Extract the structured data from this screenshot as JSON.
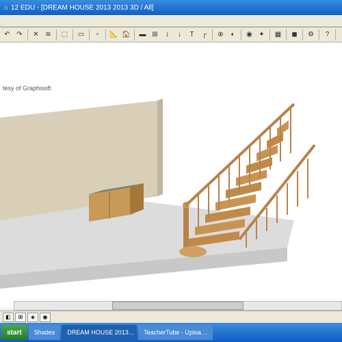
{
  "titlebar": {
    "app_icon": "⌂",
    "title": "12 EDU - [DREAM HOUSE 2013 2013 3D / All]"
  },
  "menubar": {
    "text": ""
  },
  "toolbar": {
    "items": [
      {
        "icon": "↶",
        "name": "undo-icon"
      },
      {
        "icon": "↷",
        "name": "redo-icon"
      },
      {
        "sep": true
      },
      {
        "icon": "✕",
        "name": "close-icon"
      },
      {
        "icon": "≋",
        "name": "tool-icon"
      },
      {
        "sep": true
      },
      {
        "icon": "⬚",
        "name": "window-icon"
      },
      {
        "sep": true
      },
      {
        "icon": "▭",
        "name": "select-icon"
      },
      {
        "sep": true
      },
      {
        "icon": "▫",
        "name": "element-icon"
      },
      {
        "sep": true
      },
      {
        "icon": "📐",
        "name": "measure-icon"
      },
      {
        "icon": "🏠",
        "name": "house-icon"
      },
      {
        "sep": true
      },
      {
        "icon": "▬",
        "name": "wall-icon"
      },
      {
        "icon": "⊞",
        "name": "grid-icon"
      },
      {
        "icon": "↕",
        "name": "height-icon"
      },
      {
        "icon": "↓",
        "name": "drop-icon"
      },
      {
        "icon": "T",
        "name": "text-icon"
      },
      {
        "icon": "┌",
        "name": "corner-icon"
      },
      {
        "sep": true
      },
      {
        "icon": "⊕",
        "name": "add-icon"
      },
      {
        "icon": "◐",
        "name": "shade-icon"
      },
      {
        "sep": true
      },
      {
        "icon": "◉",
        "name": "target-icon"
      },
      {
        "icon": "✦",
        "name": "star-icon"
      },
      {
        "sep": true
      },
      {
        "icon": "▦",
        "name": "hatch-icon"
      },
      {
        "sep": true
      },
      {
        "icon": "◼",
        "name": "fill-icon"
      },
      {
        "sep": true
      },
      {
        "icon": "⚙",
        "name": "settings-icon"
      },
      {
        "sep": true
      },
      {
        "icon": "?",
        "name": "help-icon"
      },
      {
        "sep": true
      }
    ]
  },
  "status": {
    "text": "tesy of Graphisoft"
  },
  "scene": {
    "floor_color": "#dcdcdc",
    "wall_color": "#d9cfb8",
    "cabinet_body": "#c89a5a",
    "cabinet_top": "#7a8270",
    "stair_wood": "#c08a4a",
    "stair_rail": "#b8824a"
  },
  "bottombar": {
    "items": [
      "◧",
      "⊞",
      "◈",
      "◉"
    ]
  },
  "taskbar": {
    "start": "start",
    "items": [
      {
        "label": "Shades",
        "active": false
      },
      {
        "label": "DREAM HOUSE 2013…",
        "active": true
      },
      {
        "label": "TeacherTube - Uploa…",
        "active": false
      }
    ]
  }
}
